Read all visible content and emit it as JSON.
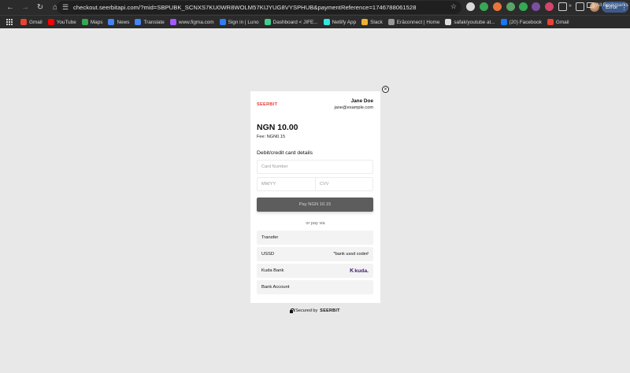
{
  "browser": {
    "url": "checkout.seerbitapi.com/?mid=SBPUBK_SCNXS7KU0WR8WOLM57KIJYUG8VYSPHUB&paymentReference=1746788061528",
    "error_label": "Error",
    "nav_icons": [
      "back-icon",
      "forward-icon",
      "reload-icon",
      "home-icon"
    ],
    "bookmarks": [
      {
        "label": "Gmail",
        "color": "#e94335"
      },
      {
        "label": "YouTube",
        "color": "#ff0000"
      },
      {
        "label": "Maps",
        "color": "#34a853"
      },
      {
        "label": "News",
        "color": "#4285f4"
      },
      {
        "label": "Translate",
        "color": "#4285f4"
      },
      {
        "label": "www.figma.com",
        "color": "#a259ff"
      },
      {
        "label": "Sign in | Luno",
        "color": "#2e7cf6"
      },
      {
        "label": "Dashboard < JIFE...",
        "color": "#3ecf8e"
      },
      {
        "label": "Netlify App",
        "color": "#32e6e2"
      },
      {
        "label": "Slack",
        "color": "#ecb22e"
      },
      {
        "label": "Erāconnect | Home",
        "color": "#999999"
      },
      {
        "label": "safak/youtube at...",
        "color": "#dddddd"
      },
      {
        "label": "(20) Facebook",
        "color": "#1877f2"
      },
      {
        "label": "Gmail",
        "color": "#e94335"
      }
    ],
    "all_bookmarks_label": "All Bookmarks"
  },
  "checkout": {
    "brand_logo": "SEERBIT",
    "customer_name": "Jane Doe",
    "customer_email": "jane@example.com",
    "amount": "NGN 10.00",
    "fee": "Fee: NGN0.15",
    "section_title": "Debit/credit card details",
    "card_number_placeholder": "Card Number",
    "expiry_placeholder": "MM/YY",
    "cvv_placeholder": "CVV",
    "pay_button": "Pay NGN 10.15",
    "or_pay_via": "or pay via",
    "options": [
      {
        "label": "Transfer",
        "right": ""
      },
      {
        "label": "USSD",
        "right": "*bank ussd code#"
      },
      {
        "label": "Kuda Bank",
        "right": "kuda."
      },
      {
        "label": "Bank Account",
        "right": ""
      }
    ],
    "secured_by": "Secured by",
    "secured_brand": "SEERBIT"
  },
  "colors": {
    "brand_red": "#e23a32",
    "pay_button_bg": "#5d5d5d",
    "kuda_purple": "#40196d",
    "error_pill": "#3d5a8a"
  }
}
